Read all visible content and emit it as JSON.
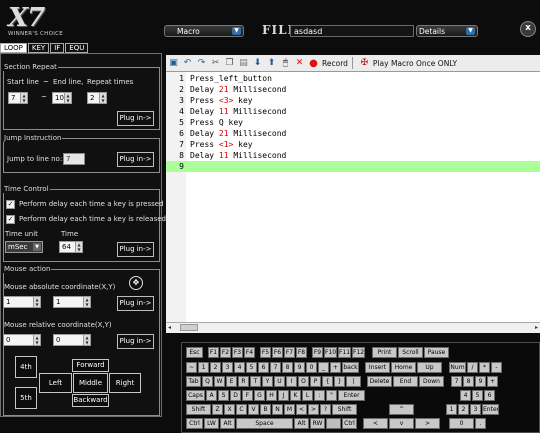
{
  "app": {
    "logo": "X7",
    "subtitle": "WINNER'S CHOICE"
  },
  "header": {
    "mode_label": "Macro",
    "file_label": "FILE",
    "file_value": "asdasd",
    "details_label": "Details",
    "close_label": "x"
  },
  "tabs": [
    {
      "label": "LOOP",
      "active": true
    },
    {
      "label": "KEY"
    },
    {
      "label": "IF"
    },
    {
      "label": "EQU"
    }
  ],
  "section_repeat": {
    "title": "Section Repeat",
    "start_label": "Start line",
    "tilde1": "~",
    "end_label": "End line,",
    "repeat_label": "Repeat times",
    "start": "7",
    "tilde2": "~",
    "end": "10",
    "repeat": "2",
    "plugin": "Plug in->"
  },
  "jump": {
    "title": "Jump Instruction",
    "label": "Jump to line no:",
    "value": "7",
    "plugin": "Plug in->"
  },
  "time_control": {
    "title": "Time Control",
    "opt1": "Perform delay each time a key is pressed",
    "opt2": "Perform delay each time a key is released",
    "unit_label": "Time unit",
    "time_label": "Time",
    "unit": "mSec",
    "time": "64",
    "plugin": "Plug in->"
  },
  "mouse": {
    "title": "Mouse action",
    "abs_label": "Mouse absolute coordinate(X,Y)",
    "abs_x": "1",
    "abs_y": "1",
    "plugin1": "Plug in->",
    "rel_label": "Mouse relative coordinate(X,Y)",
    "rel_x": "0",
    "rel_y": "0",
    "plugin2": "Plug in->",
    "keys": {
      "k4": "4th",
      "k5": "5th",
      "fwd": "Forward",
      "back": "Backward",
      "left": "Left",
      "middle": "Middle",
      "right": "Right"
    }
  },
  "toolbar": {
    "record": "Record",
    "play": "Play Macro Once ONLY"
  },
  "script_lines": [
    {
      "n": "1",
      "a": "Press_left_button",
      "num": "",
      "b": ""
    },
    {
      "n": "2",
      "a": "Delay ",
      "num": "21",
      "b": " Millisecond"
    },
    {
      "n": "3",
      "a": "Press ",
      "num": "<3>",
      "b": " key"
    },
    {
      "n": "4",
      "a": "Delay ",
      "num": "11",
      "b": " Millisecond"
    },
    {
      "n": "5",
      "a": "Press Q key",
      "num": "",
      "b": ""
    },
    {
      "n": "6",
      "a": "Delay ",
      "num": "21",
      "b": " Millisecond"
    },
    {
      "n": "7",
      "a": "Press ",
      "num": "<1>",
      "b": " key"
    },
    {
      "n": "8",
      "a": "Delay ",
      "num": "11",
      "b": " Millisecond"
    },
    {
      "n": "9",
      "a": "",
      "num": "",
      "b": ""
    }
  ],
  "keyboard": {
    "row1": [
      "Esc",
      "F1",
      "F2",
      "F3",
      "F4",
      "F5",
      "F6",
      "F7",
      "F8",
      "F9",
      "F10",
      "F11",
      "F12",
      "Print",
      "Scroll",
      "Pause"
    ],
    "row2": [
      "~",
      "1",
      "2",
      "3",
      "4",
      "5",
      "6",
      "7",
      "8",
      "9",
      "0",
      "_",
      "+",
      "back",
      "Insert",
      "Home",
      "Up",
      "Num",
      "/",
      "*",
      "-"
    ],
    "row3": [
      "Tab",
      "Q",
      "W",
      "E",
      "R",
      "T",
      "Y",
      "U",
      "I",
      "O",
      "P",
      "{",
      "}",
      "|",
      "Delete",
      "End",
      "Down",
      "7",
      "8",
      "9",
      "+"
    ],
    "row4": [
      "Caps",
      "A",
      "S",
      "D",
      "F",
      "G",
      "H",
      "J",
      "K",
      "L",
      ":",
      "\"",
      "Enter",
      "4",
      "5",
      "6"
    ],
    "row5": [
      "Shift",
      "Z",
      "X",
      "C",
      "V",
      "B",
      "N",
      "M",
      "<",
      ">",
      "?",
      "Shift",
      "^",
      "1",
      "2",
      "3",
      "Enter"
    ],
    "row6": [
      "Ctrl",
      "LW",
      "Alt",
      "Space",
      "Alt",
      "RW",
      "",
      "Ctrl",
      "<",
      "v",
      ">",
      "0",
      "."
    ]
  }
}
